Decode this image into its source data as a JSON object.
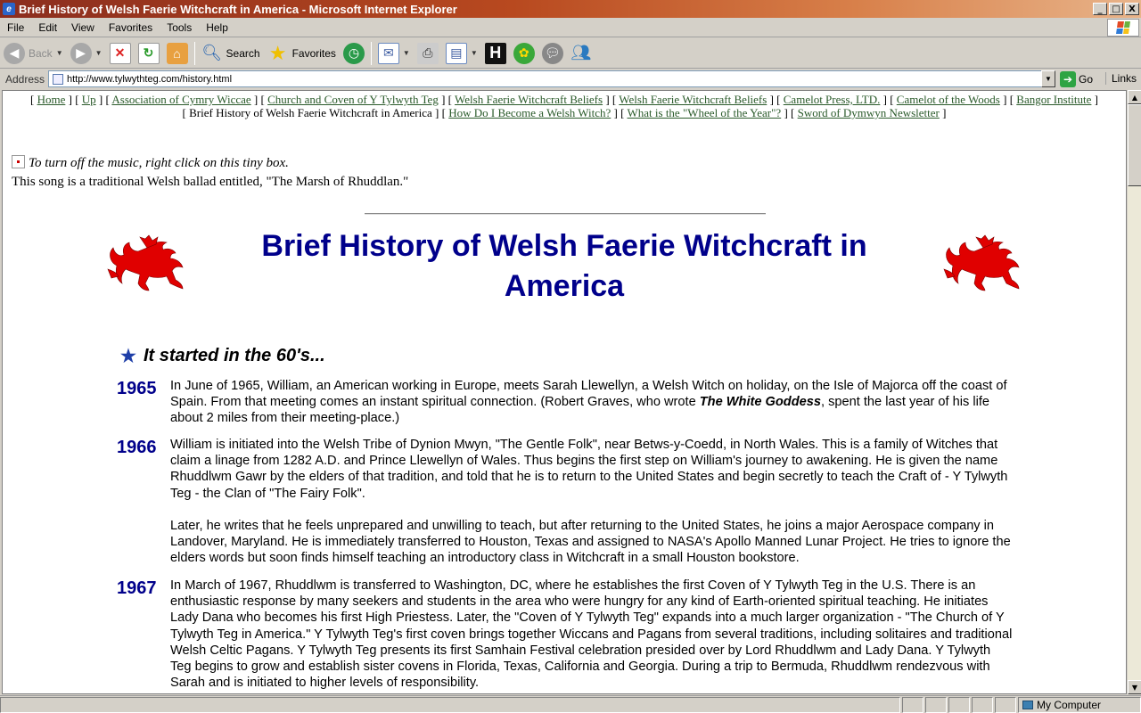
{
  "window": {
    "title": "Brief History of Welsh Faerie Witchcraft in America - Microsoft Internet Explorer",
    "buttons": {
      "minimize": "_",
      "maximize": "□",
      "close": "X"
    }
  },
  "menu": [
    "File",
    "Edit",
    "View",
    "Favorites",
    "Tools",
    "Help"
  ],
  "toolbar": {
    "back": "Back",
    "search": "Search",
    "favorites": "Favorites"
  },
  "address": {
    "label": "Address",
    "url": "http://www.tylwythteg.com/history.html",
    "go": "Go",
    "links": "Links"
  },
  "page": {
    "nav_row1": [
      {
        "label": "Home",
        "link": true
      },
      {
        "label": "Up",
        "link": true
      },
      {
        "label": "Association of Cymry Wiccae",
        "link": true
      },
      {
        "label": "Church and Coven of Y Tylwyth Teg",
        "link": true
      },
      {
        "label": "Welsh Faerie Witchcraft Beliefs",
        "link": true
      },
      {
        "label": "Welsh Faerie Witchcraft Beliefs",
        "link": true
      },
      {
        "label": "Camelot Press, LTD.",
        "link": true
      },
      {
        "label": "Camelot of the Woods",
        "link": true
      },
      {
        "label": "Bangor Institute",
        "link": true
      }
    ],
    "nav_row2": [
      {
        "label": "Brief History of Welsh Faerie Witchcraft in America",
        "link": false
      },
      {
        "label": "How Do I Become a Welsh Witch?",
        "link": true
      },
      {
        "label": "What is the \"Wheel of the Year\"?",
        "link": true
      },
      {
        "label": "Sword of Dymwyn Newsletter",
        "link": true
      }
    ],
    "music_hint": "To turn off the music, right click on this tiny box.",
    "song_note": "This song is a traditional Welsh ballad entitled, \"The Marsh of Rhuddlan.\"",
    "heading": "Brief History of Welsh Faerie Witchcraft in America",
    "subheading": "It started in the 60's...",
    "entries": [
      {
        "year": "1965",
        "p1_before": "In June of 1965, William, an American working in Europe, meets Sarah Llewellyn, a Welsh Witch on holiday, on the Isle of Majorca off the coast of Spain. From that meeting comes an instant spiritual connection. (Robert Graves, who wrote ",
        "p1_em": "The White Goddess",
        "p1_after": ", spent the last year of his life about 2 miles from their meeting-place.)"
      },
      {
        "year": "1966",
        "p1": "William is initiated into the Welsh Tribe of Dynion Mwyn, \"The Gentle Folk\", near Betws-y-Coedd, in North Wales. This is a family of Witches that claim a linage from 1282 A.D. and Prince Llewellyn of Wales. Thus begins the first step on William's journey to awakening. He is given the name Rhuddlwm Gawr by the elders of that tradition, and told that he is to return to the United States and begin secretly to teach the Craft of - Y Tylwyth Teg - the Clan of \"The Fairy Folk\".",
        "p2": "Later, he writes that he feels unprepared and unwilling to teach, but after returning to the United States, he joins a major Aerospace company in Landover, Maryland. He is immediately transferred to Houston, Texas and assigned to NASA's Apollo Manned Lunar Project. He tries to ignore the elders words but soon finds himself teaching an introductory class in Witchcraft in a small Houston bookstore."
      },
      {
        "year": "1967",
        "p1": "In March of 1967, Rhuddlwm is transferred to Washington, DC, where he establishes the first Coven of Y Tylwyth Teg in the U.S. There is an enthusiastic response by many seekers and students in the area who were hungry for any kind of Earth-oriented spiritual teaching. He initiates Lady Dana who becomes his first High Priestess. Later, the \"Coven of Y Tylwyth Teg\" expands into a much larger organization - \"The Church of Y Tylwyth Teg in America.\" Y Tylwyth Teg's first coven brings together Wiccans and Pagans from several traditions, including solitaires and traditional Welsh Celtic Pagans. Y Tylwyth Teg presents its first Samhain Festival celebration presided over by Lord Rhuddlwm and Lady Dana. Y Tylwyth Teg begins to grow and establish sister covens in Florida, Texas, California and Georgia. During a trip to Bermuda, Rhuddlwm rendezvous with Sarah and is initiated to higher levels of responsibility."
      }
    ]
  },
  "status": {
    "zone": "My Computer"
  },
  "colors": {
    "heading": "#00008b",
    "link": "#2a5a2a",
    "dragon": "#e00000"
  }
}
